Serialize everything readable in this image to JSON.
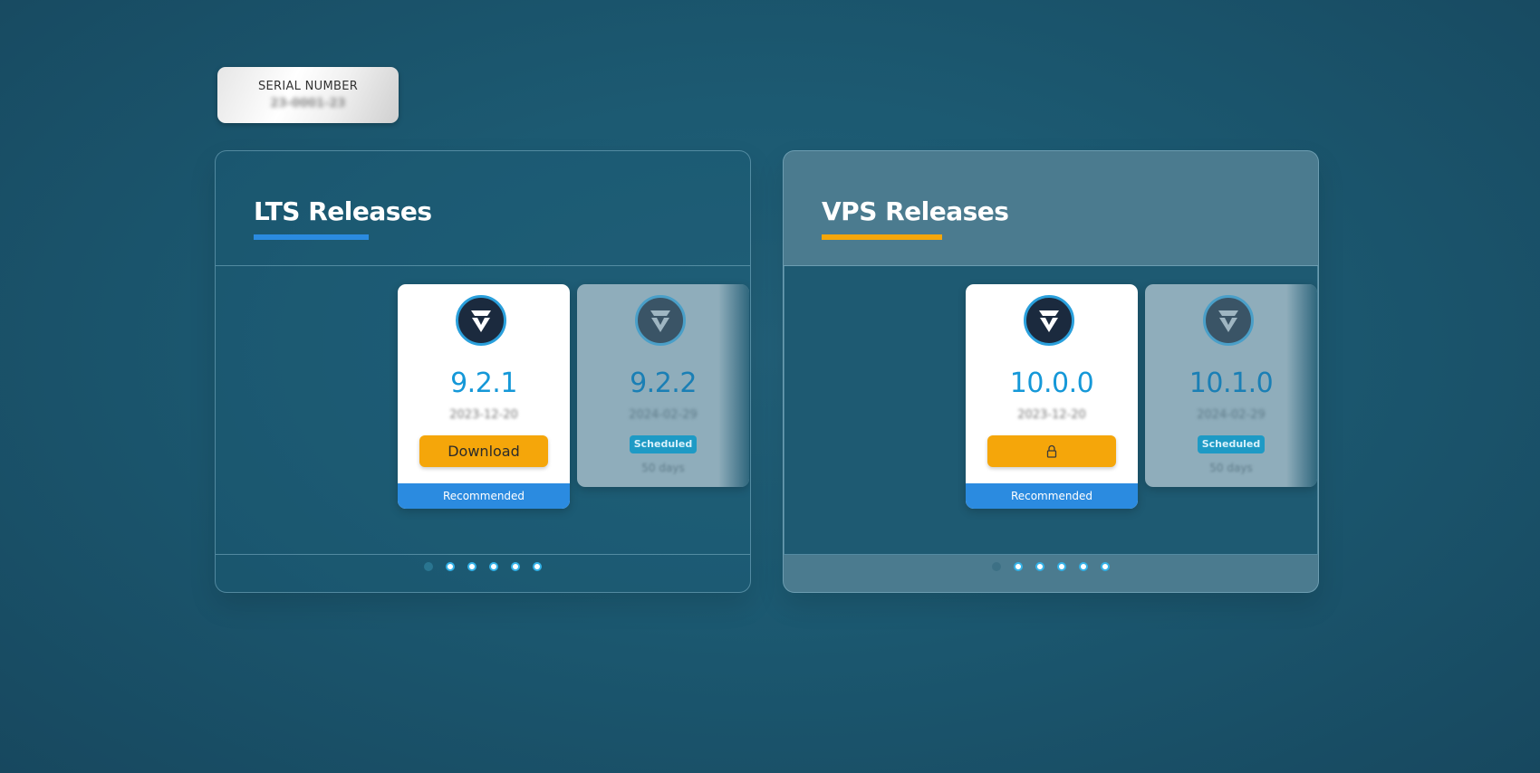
{
  "serial": {
    "label": "SERIAL NUMBER",
    "value": "23-0001-23"
  },
  "panels": {
    "lts": {
      "title": "LTS Releases",
      "accent": "#2b8be0",
      "current": {
        "version": "9.2.1",
        "date": "2023-12-20",
        "button_label": "Download",
        "tag": "Recommended"
      },
      "next": {
        "version": "9.2.2",
        "date": "2024-02-29",
        "status": "Scheduled",
        "countdown": "50 days"
      },
      "pagination": {
        "total": 6,
        "active_index": 0
      }
    },
    "vps": {
      "title": "VPS Releases",
      "accent": "#f5a60a",
      "current": {
        "version": "10.0.0",
        "date": "2023-12-20",
        "button_icon": "lock-icon",
        "tag": "Recommended"
      },
      "next": {
        "version": "10.1.0",
        "date": "2024-02-29",
        "status": "Scheduled",
        "countdown": "50 days"
      },
      "pagination": {
        "total": 6,
        "active_index": 0
      }
    }
  },
  "colors": {
    "background": "#1c5a72",
    "version_text": "#1598d8",
    "button": "#f5a60a",
    "recommended_bar": "#2b8be0",
    "scheduled_badge": "#1e9ac5"
  }
}
